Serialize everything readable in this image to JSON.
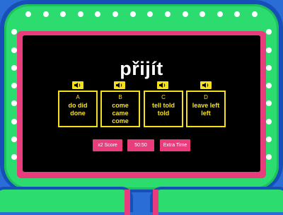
{
  "question": "přijít",
  "options": [
    {
      "letter": "A",
      "text": "do did done"
    },
    {
      "letter": "B",
      "text": "come came come"
    },
    {
      "letter": "C",
      "text": "tell told told"
    },
    {
      "letter": "D",
      "text": "leave left left"
    }
  ],
  "powerups": {
    "double": "x2 Score",
    "fifty": "50:50",
    "time": "Extra Time"
  },
  "colors": {
    "frame_blue": "#174fb8",
    "frame_green": "#2ddc6e",
    "accent_pink": "#e83c7d",
    "option_yellow": "#f5e11a",
    "screen": "#000000"
  },
  "icons": [
    "speaker-icon",
    "light-bulb-icon"
  ]
}
